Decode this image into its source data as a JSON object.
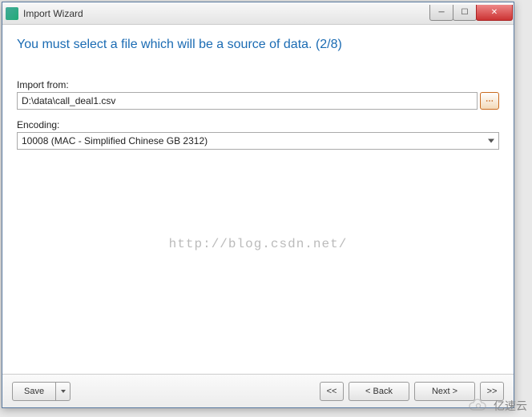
{
  "titlebar": {
    "title": "Import Wizard"
  },
  "heading": "You must select a file which will be a source of data. (2/8)",
  "import": {
    "label": "Import from:",
    "value": "D:\\data\\call_deal1.csv"
  },
  "encoding": {
    "label": "Encoding:",
    "value": "10008 (MAC - Simplified Chinese GB 2312)"
  },
  "watermark": "http://blog.csdn.net/",
  "footer": {
    "save": "Save",
    "first": "<<",
    "back": "< Back",
    "next": "Next >",
    "last": ">>"
  },
  "site_watermark": "亿速云"
}
